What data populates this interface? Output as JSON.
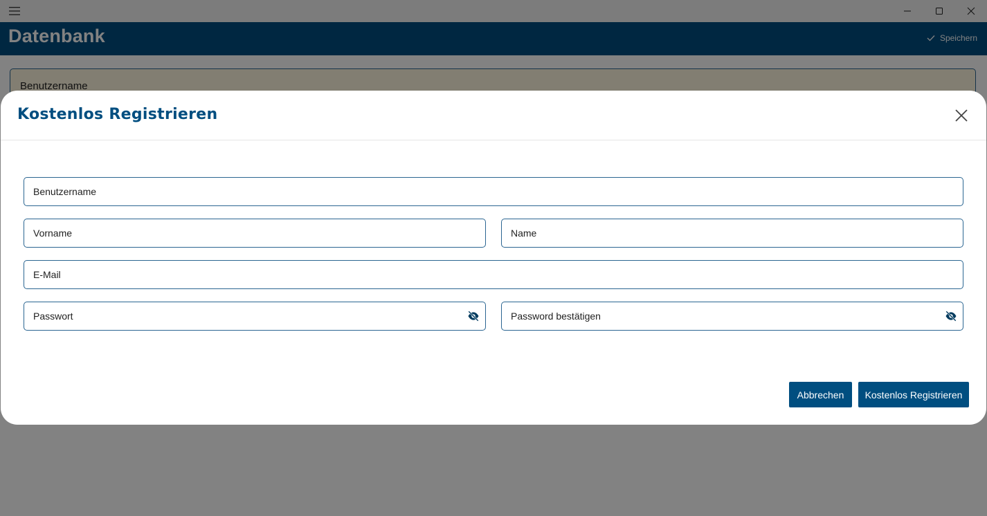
{
  "window": {
    "menu_icon": "hamburger-icon",
    "controls": [
      "minimize-icon",
      "maximize-icon",
      "close-icon"
    ]
  },
  "app": {
    "title": "Datenbank",
    "save_label": "Speichern",
    "save_icon": "checkmark-icon"
  },
  "background": {
    "field_label": "Benutzername"
  },
  "dialog": {
    "title": "Kostenlos Registrieren",
    "close_icon": "close-icon",
    "fields": {
      "username": {
        "placeholder": "Benutzername",
        "value": ""
      },
      "firstname": {
        "placeholder": "Vorname",
        "value": ""
      },
      "lastname": {
        "placeholder": "Name",
        "value": ""
      },
      "email": {
        "placeholder": "E-Mail",
        "value": ""
      },
      "password": {
        "placeholder": "Passwort",
        "value": "",
        "icon": "eye-off-icon"
      },
      "password_confirm": {
        "placeholder": "Password bestätigen",
        "value": "",
        "icon": "eye-off-icon"
      }
    },
    "buttons": {
      "cancel": "Abbrechen",
      "register": "Kostenlos Registrieren"
    }
  },
  "colors": {
    "brand": "#004e80",
    "field_border": "#2a6591",
    "overlay": "rgba(0,0,0,0.49)"
  }
}
